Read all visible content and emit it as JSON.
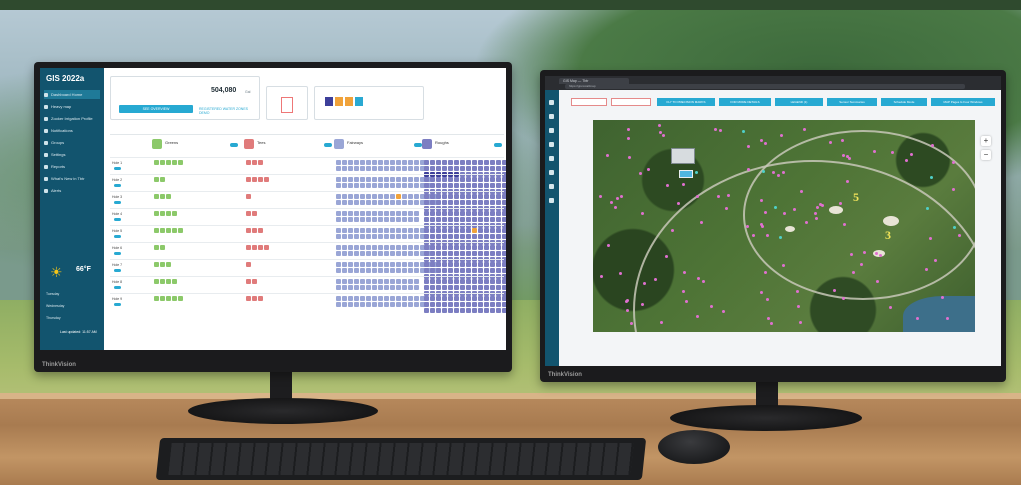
{
  "left_app": {
    "title": "GIS 2022a",
    "nav": [
      {
        "label": "Dashboard Home",
        "active": true
      },
      {
        "label": "Heavy map",
        "active": false
      },
      {
        "label": "Zooker Irrigation Profile",
        "active": false
      },
      {
        "label": "Notifications",
        "active": false
      },
      {
        "label": "Groups",
        "active": false
      },
      {
        "label": "Settings",
        "active": false
      },
      {
        "label": "Reports",
        "active": false
      },
      {
        "label": "What's New in Tbtr",
        "active": false
      },
      {
        "label": "Alerts",
        "active": false
      }
    ],
    "weather": {
      "temp": "66°F",
      "rows": [
        "Tuesday",
        "Wednesday",
        "Thursday"
      ],
      "updated": "Last updated: 11:57 AM"
    },
    "top": {
      "stat_value": "504,080",
      "stat_unit": "Gal",
      "primary_button": "SEE OVERVIEW",
      "link": "REGISTERED WATER ZONES DEMO"
    },
    "columns": [
      {
        "name": "Greens",
        "color": "#8cc96a"
      },
      {
        "name": "Tees",
        "color": "#e07b7b"
      },
      {
        "name": "Fairways",
        "color": "#9aa6d6"
      },
      {
        "name": "Roughs",
        "color": "#7c7ec2"
      }
    ],
    "holes": [
      "Hole 1",
      "Hole 2",
      "Hole 3",
      "Hole 4",
      "Hole 5",
      "Hole 6",
      "Hole 7",
      "Hole 8",
      "Hole 9"
    ]
  },
  "right_app": {
    "browser_tab": "GIS Map — Tbtr",
    "address": "https://gis.local/map",
    "toolbar": [
      {
        "label": "",
        "style": "plain"
      },
      {
        "label": "",
        "style": "plain"
      },
      {
        "label": "FLY TO PRECISION MARKS",
        "style": "teal"
      },
      {
        "label": "FOR MORE DETAILS",
        "style": "teal"
      },
      {
        "label": "LEGEND (1)",
        "style": "teal"
      },
      {
        "label": "Sensor Summaries",
        "style": "teal"
      },
      {
        "label": "Schedule Mode",
        "style": "teal"
      },
      {
        "label": "MAP Pages Is Four Windows",
        "style": "teal"
      }
    ],
    "hole_numbers": [
      "5",
      "3"
    ],
    "zoom_in": "+",
    "zoom_out": "−"
  },
  "brand": "ThinkVision",
  "colors": {
    "sidebar": "#12546e",
    "accent": "#27a9d2"
  }
}
